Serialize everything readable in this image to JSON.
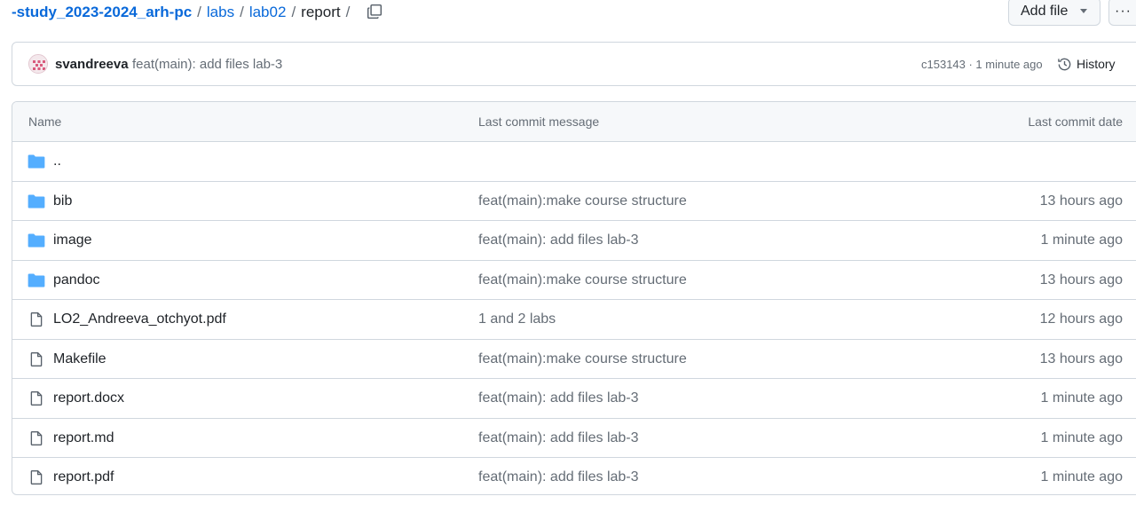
{
  "breadcrumb": {
    "repo": "-study_2023-2024_arh-pc",
    "sep": "/",
    "path1": "labs",
    "path2": "lab02",
    "current": "report"
  },
  "buttons": {
    "add_file": "Add file",
    "more": "···"
  },
  "commit": {
    "author": "svandreeva",
    "message": "feat(main): add files lab-3",
    "meta": "c153143 · 1 minute ago",
    "history_label": "History"
  },
  "table": {
    "headers": {
      "name": "Name",
      "message": "Last commit message",
      "date": "Last commit date"
    },
    "rows": [
      {
        "name": "..",
        "type": "folder-icon",
        "message": "",
        "date": ""
      },
      {
        "name": "bib",
        "type": "folder-icon",
        "message": "feat(main):make course structure",
        "date": "13 hours ago"
      },
      {
        "name": "image",
        "type": "folder-icon",
        "message": "feat(main): add files lab-3",
        "date": "1 minute ago"
      },
      {
        "name": "pandoc",
        "type": "folder-icon",
        "message": "feat(main):make course structure",
        "date": "13 hours ago"
      },
      {
        "name": "LO2_Andreeva_otchyot.pdf",
        "type": "file-icon",
        "message": "1 and 2 labs",
        "date": "12 hours ago"
      },
      {
        "name": "Makefile",
        "type": "file-icon",
        "message": "feat(main):make course structure",
        "date": "13 hours ago"
      },
      {
        "name": "report.docx",
        "type": "file-icon",
        "message": "feat(main): add files lab-3",
        "date": "1 minute ago"
      },
      {
        "name": "report.md",
        "type": "file-icon",
        "message": "feat(main): add files lab-3",
        "date": "1 minute ago"
      },
      {
        "name": "report.pdf",
        "type": "file-icon",
        "message": "feat(main): add files lab-3",
        "date": "1 minute ago"
      }
    ]
  },
  "colors": {
    "link": "#0969da",
    "folder": "#54aeff",
    "muted": "#656d76",
    "border": "#d0d7de"
  }
}
